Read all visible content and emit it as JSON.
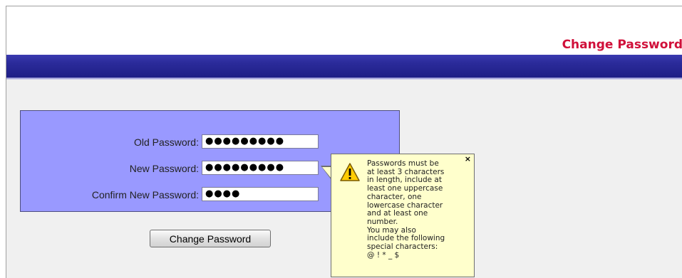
{
  "header": {
    "title": "Change Password"
  },
  "form": {
    "fields": [
      {
        "label": "Old Password:",
        "value": "●●●●●●●●●"
      },
      {
        "label": "New Password:",
        "value": "●●●●●●●●●"
      },
      {
        "label": "Confirm New Password:",
        "value": "●●●●"
      }
    ],
    "submit_label": "Change Password"
  },
  "tooltip": {
    "close_glyph": "×",
    "icon": "warning-icon",
    "lines": [
      "Passwords must be",
      "at least 3 characters",
      "in length, include at",
      "least one uppercase",
      "character, one",
      "lowercase character",
      "and at least one",
      "number.",
      "You may also",
      "include the following",
      "special characters:",
      "@ ! * _ $"
    ]
  },
  "colors": {
    "title": "#d0103a",
    "header_band": "#2b2b9a",
    "form_panel": "#9999ff",
    "tooltip_bg": "#ffffcc",
    "warning_icon": "#ffcc00"
  }
}
